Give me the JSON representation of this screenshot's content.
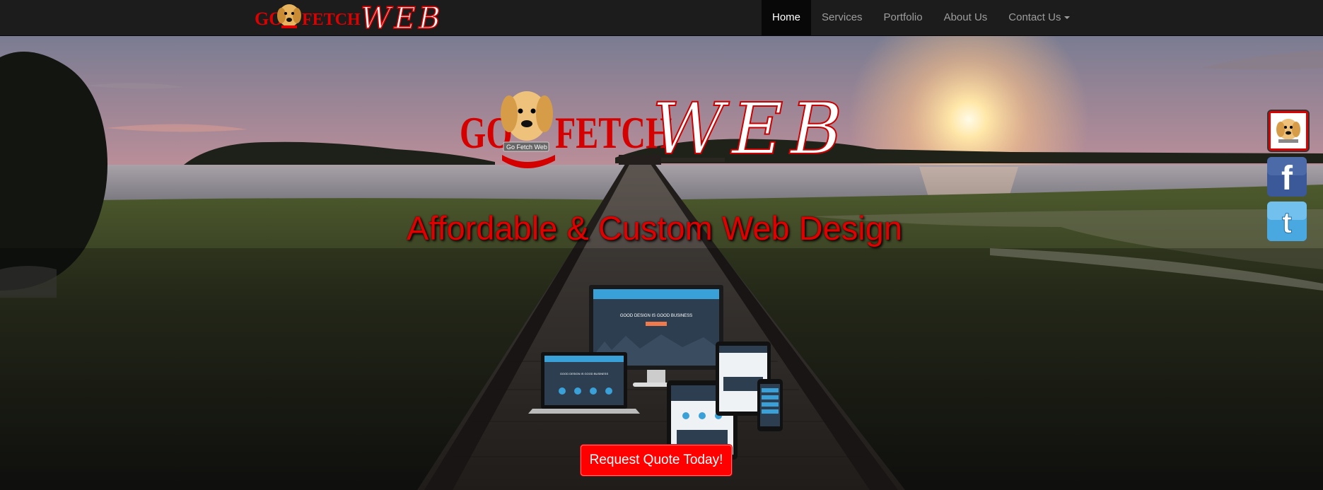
{
  "brand": {
    "go": "GO",
    "fetch": "FETCH",
    "web": "WEB",
    "tag": "Go Fetch Web"
  },
  "nav": {
    "items": [
      {
        "label": "Home",
        "active": true
      },
      {
        "label": "Services"
      },
      {
        "label": "Portfolio"
      },
      {
        "label": "About Us"
      },
      {
        "label": "Contact Us"
      }
    ]
  },
  "hero": {
    "tagline": "Affordable & Custom Web Design",
    "cta": "Request Quote Today!",
    "devices": {
      "desktop_header": "GOOD DESIGN IS GOOD BUSINESS",
      "laptop_header": "GOOD DESIGN IS GOOD BUSINESS"
    }
  },
  "social": [
    {
      "icon": "go-fetch-web-icon"
    },
    {
      "icon": "facebook-icon",
      "letter": "f"
    },
    {
      "icon": "twitter-icon",
      "letter": "t"
    }
  ],
  "colors": {
    "navbar": "#1c1c1c",
    "accent_red": "#ff0000",
    "tagline_red": "#e00000",
    "facebook": "#3b5998",
    "twitter": "#55acee"
  }
}
